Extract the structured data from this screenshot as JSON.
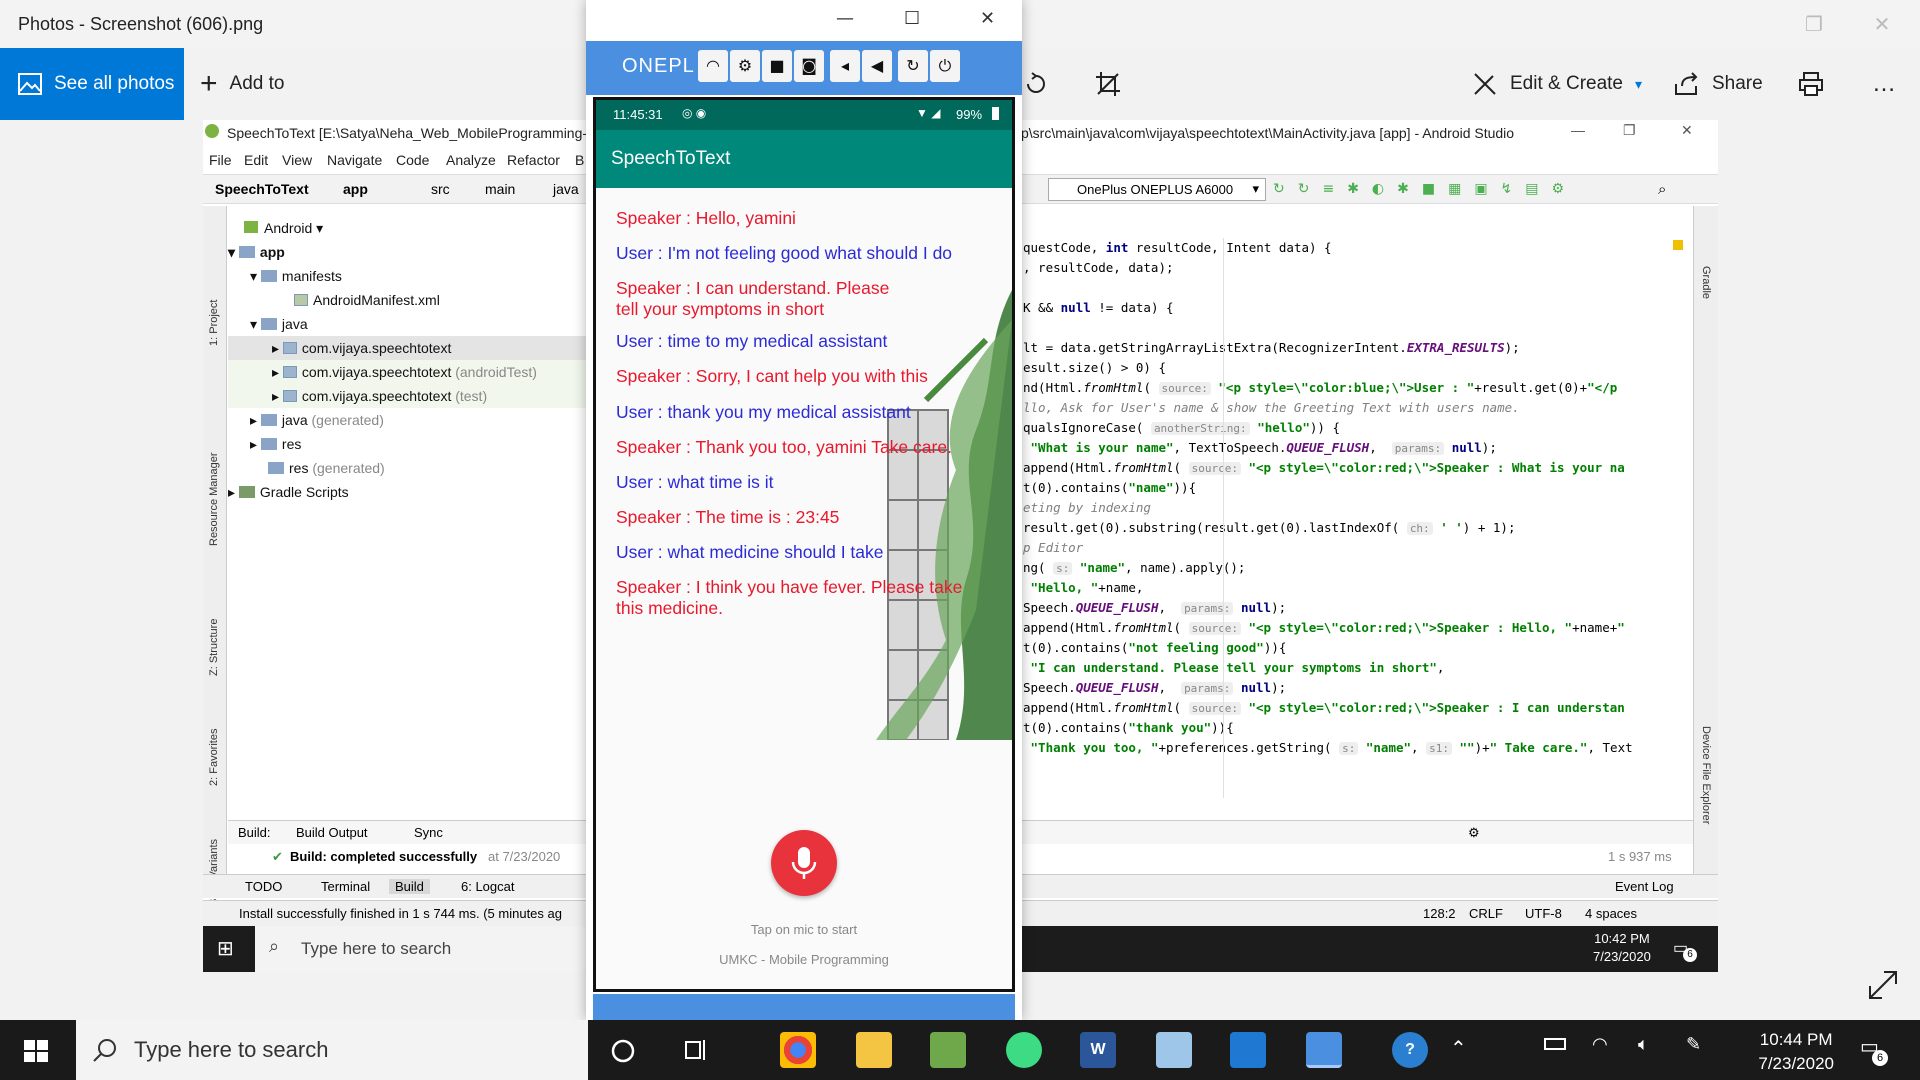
{
  "photos": {
    "title": "Photos - Screenshot (606).png",
    "see_all": "See all photos",
    "add_to": "Add to",
    "edit_create": "Edit & Create",
    "share": "Share"
  },
  "studio": {
    "title_left": "SpeechToText [E:\\Satya\\Neha_Web_MobileProgramming-r",
    "title_right": "p\\src\\main\\java\\com\\vijaya\\speechtotext\\MainActivity.java [app] - Android Studio",
    "menu": [
      "File",
      "Edit",
      "View",
      "Navigate",
      "Code",
      "Analyze",
      "Refactor",
      "B"
    ],
    "breadcrumb": [
      "SpeechToText",
      "app",
      "src",
      "main",
      "java"
    ],
    "device": "OnePlus ONEPLUS A6000",
    "project_view": "Android",
    "tree": [
      {
        "label": "app",
        "extra": ""
      },
      {
        "label": "manifests",
        "extra": ""
      },
      {
        "label": "AndroidManifest.xml",
        "extra": ""
      },
      {
        "label": "java",
        "extra": ""
      },
      {
        "label": "com.vijaya.speechtotext",
        "extra": ""
      },
      {
        "label": "com.vijaya.speechtotext",
        "extra": "(androidTest)"
      },
      {
        "label": "com.vijaya.speechtotext",
        "extra": "(test)"
      },
      {
        "label": "java",
        "extra": "(generated)"
      },
      {
        "label": "res",
        "extra": ""
      },
      {
        "label": "res",
        "extra": "(generated)"
      },
      {
        "label": "Gradle Scripts",
        "extra": ""
      }
    ],
    "side_tabs": [
      "1: Project",
      "Resource Manager",
      "Z: Structure",
      "2: Favorites",
      "Build Variants"
    ],
    "right_tabs": [
      "Gradle",
      "Device File Explorer"
    ],
    "build_label": "Build:",
    "build_tabs": [
      "Build Output",
      "Sync"
    ],
    "build_status": "Build: completed successfully",
    "build_time": "at 7/23/2020",
    "build_duration": "1 s 937 ms",
    "bottom_tabs": [
      "TODO",
      "Terminal",
      "Build",
      "6: Logcat"
    ],
    "event_log": "Event Log",
    "status_msg": "Install successfully finished in 1 s 744 ms. (5 minutes ag",
    "status_right": [
      "128:2",
      "CRLF",
      "UTF-8",
      "4 spaces"
    ],
    "inner_search": "Type here to search",
    "inner_time": "10:42 PM",
    "inner_date": "7/23/2020",
    "inner_notif": "6"
  },
  "phone": {
    "brand": "ONEPL",
    "status_time": "11:45:31",
    "battery": "99%",
    "app_title": "SpeechToText",
    "messages": [
      {
        "role": "speaker",
        "text": "Speaker : Hello, yamini"
      },
      {
        "role": "user",
        "text": "User : I'm not feeling good what should I do"
      },
      {
        "role": "speaker",
        "text": "Speaker : I can understand. Please tell your symptoms in short"
      },
      {
        "role": "user",
        "text": "User : time to my medical assistant"
      },
      {
        "role": "speaker",
        "text": "Speaker : Sorry, I cant help you with this"
      },
      {
        "role": "user",
        "text": "User : thank you my medical assistant"
      },
      {
        "role": "speaker",
        "text": "Speaker : Thank you too, yamini Take care."
      },
      {
        "role": "user",
        "text": "User : what time is it"
      },
      {
        "role": "speaker",
        "text": "Speaker : The time is : 23:45"
      },
      {
        "role": "user",
        "text": "User : what medicine should I take"
      },
      {
        "role": "speaker",
        "text": "Speaker : I think you have fever. Please take this medicine."
      }
    ],
    "mic_hint": "Tap on mic to start",
    "footer": "UMKC - Mobile Programming"
  },
  "taskbar": {
    "search": "Type here to search",
    "time": "10:44 PM",
    "date": "7/23/2020",
    "notif": "6"
  },
  "colors": {
    "photos_accent": "#0078d7",
    "phone_bar": "#4a8fe0",
    "app_bar": "#00897b",
    "speaker": "#e8192c",
    "user": "#2b2bd6",
    "mic": "#e8323c"
  }
}
